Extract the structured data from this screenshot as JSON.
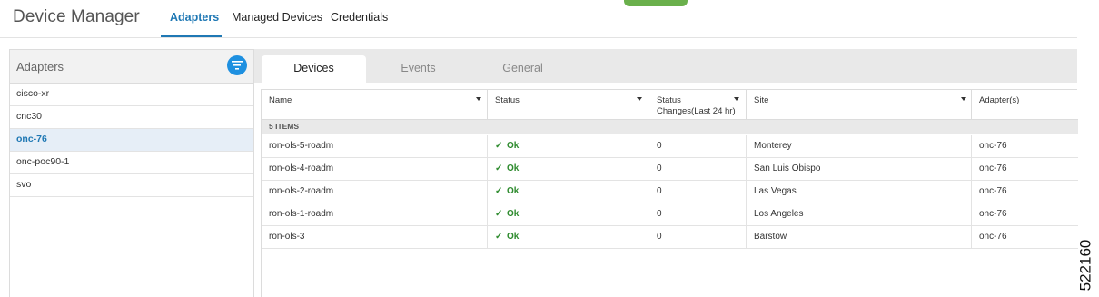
{
  "header": {
    "title": "Device Manager",
    "tabs": [
      {
        "label": "Adapters",
        "active": true
      },
      {
        "label": "Managed Devices",
        "active": false
      },
      {
        "label": "Credentials",
        "active": false
      }
    ]
  },
  "colors": {
    "accent": "#1f78b4",
    "filter_button": "#1e90e0",
    "ok": "#2e8b2e",
    "green_button": "#6ab04c"
  },
  "adapters_panel": {
    "title": "Adapters",
    "filter_icon": "filter-icon",
    "items": [
      {
        "label": "cisco-xr",
        "selected": false
      },
      {
        "label": "cnc30",
        "selected": false
      },
      {
        "label": "onc-76",
        "selected": true
      },
      {
        "label": "onc-poc90-1",
        "selected": false
      },
      {
        "label": "svo",
        "selected": false
      }
    ]
  },
  "detail_tabs": [
    {
      "label": "Devices",
      "active": true
    },
    {
      "label": "Events",
      "active": false
    },
    {
      "label": "General",
      "active": false
    }
  ],
  "grid": {
    "columns": [
      {
        "label": "Name"
      },
      {
        "label": "Status"
      },
      {
        "label": "Status Changes(Last 24 hr)"
      },
      {
        "label": "Site"
      },
      {
        "label": "Adapter(s)"
      }
    ],
    "item_count_label": "5 ITEMS",
    "rows": [
      {
        "name": "ron-ols-5-roadm",
        "status": "Ok",
        "changes": "0",
        "site": "Monterey",
        "adapter": "onc-76"
      },
      {
        "name": "ron-ols-4-roadm",
        "status": "Ok",
        "changes": "0",
        "site": "San Luis Obispo",
        "adapter": "onc-76"
      },
      {
        "name": "ron-ols-2-roadm",
        "status": "Ok",
        "changes": "0",
        "site": "Las Vegas",
        "adapter": "onc-76"
      },
      {
        "name": "ron-ols-1-roadm",
        "status": "Ok",
        "changes": "0",
        "site": "Los Angeles",
        "adapter": "onc-76"
      },
      {
        "name": "ron-ols-3",
        "status": "Ok",
        "changes": "0",
        "site": "Barstow",
        "adapter": "onc-76"
      }
    ]
  },
  "figure_id": "522160"
}
